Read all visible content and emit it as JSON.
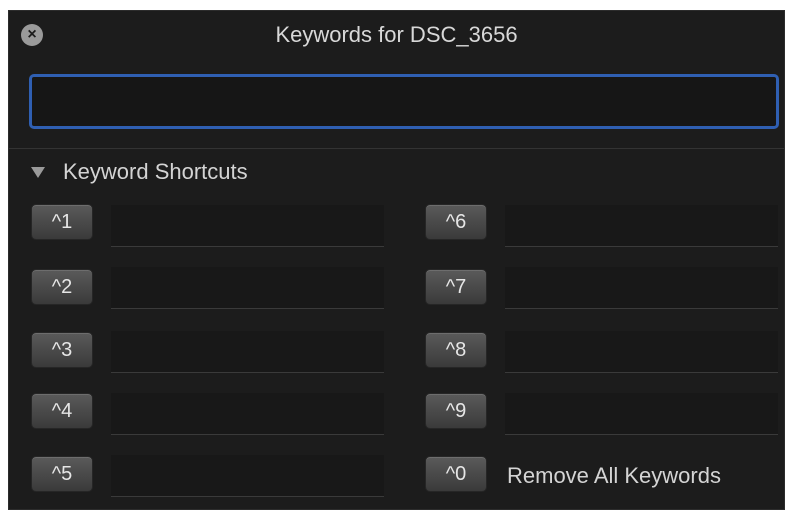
{
  "window": {
    "title": "Keywords for DSC_3656",
    "close_icon": "close-x-icon"
  },
  "keyword_input": {
    "value": "",
    "placeholder": ""
  },
  "shortcuts_section": {
    "label": "Keyword Shortcuts",
    "disclosure_icon": "disclosure-triangle-down-icon"
  },
  "shortcuts": [
    {
      "key": "^1",
      "value": ""
    },
    {
      "key": "^2",
      "value": ""
    },
    {
      "key": "^3",
      "value": ""
    },
    {
      "key": "^4",
      "value": ""
    },
    {
      "key": "^5",
      "value": ""
    },
    {
      "key": "^6",
      "value": ""
    },
    {
      "key": "^7",
      "value": ""
    },
    {
      "key": "^8",
      "value": ""
    },
    {
      "key": "^9",
      "value": ""
    },
    {
      "key": "^0"
    }
  ],
  "remove_all_label": "Remove All Keywords",
  "colors": {
    "panel_background": "#1c1c1c",
    "focus_ring": "#2f5fb2",
    "text": "#d4d4d4"
  }
}
